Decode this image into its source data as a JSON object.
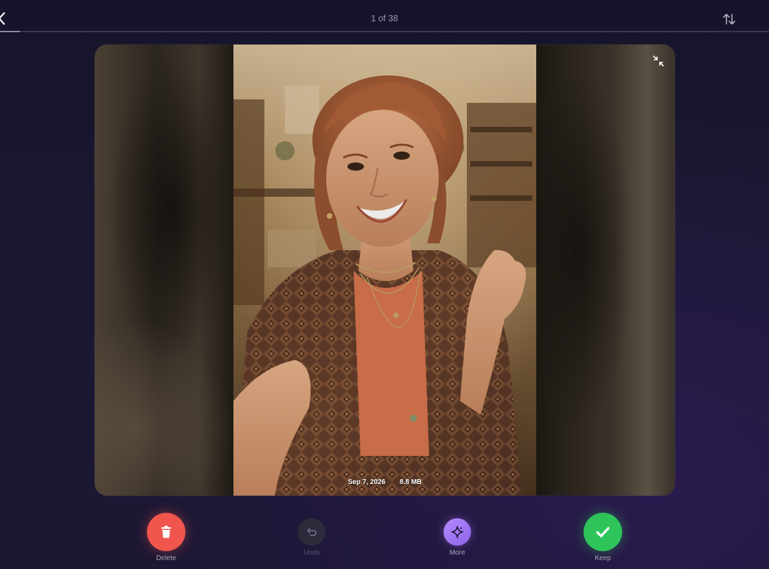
{
  "header": {
    "counter": "1 of 38",
    "progress_fraction": 0.026,
    "back_icon": "chevron-left-icon",
    "sort_icon": "sort-arrows-icon"
  },
  "photo": {
    "date": "Sep 7, 2026",
    "size": "8.8 MB",
    "collapse_icon": "collapse-icon"
  },
  "actions": {
    "delete": {
      "label": "Delete",
      "icon": "trash-icon",
      "color": "#f0564e"
    },
    "undo": {
      "label": "Undo",
      "icon": "undo-icon",
      "color": "#2c2b3b"
    },
    "more": {
      "label": "More",
      "icon": "sparkle-icon",
      "color": "#a176f5"
    },
    "keep": {
      "label": "Keep",
      "icon": "checkmark-icon",
      "color": "#2fc45a"
    }
  }
}
